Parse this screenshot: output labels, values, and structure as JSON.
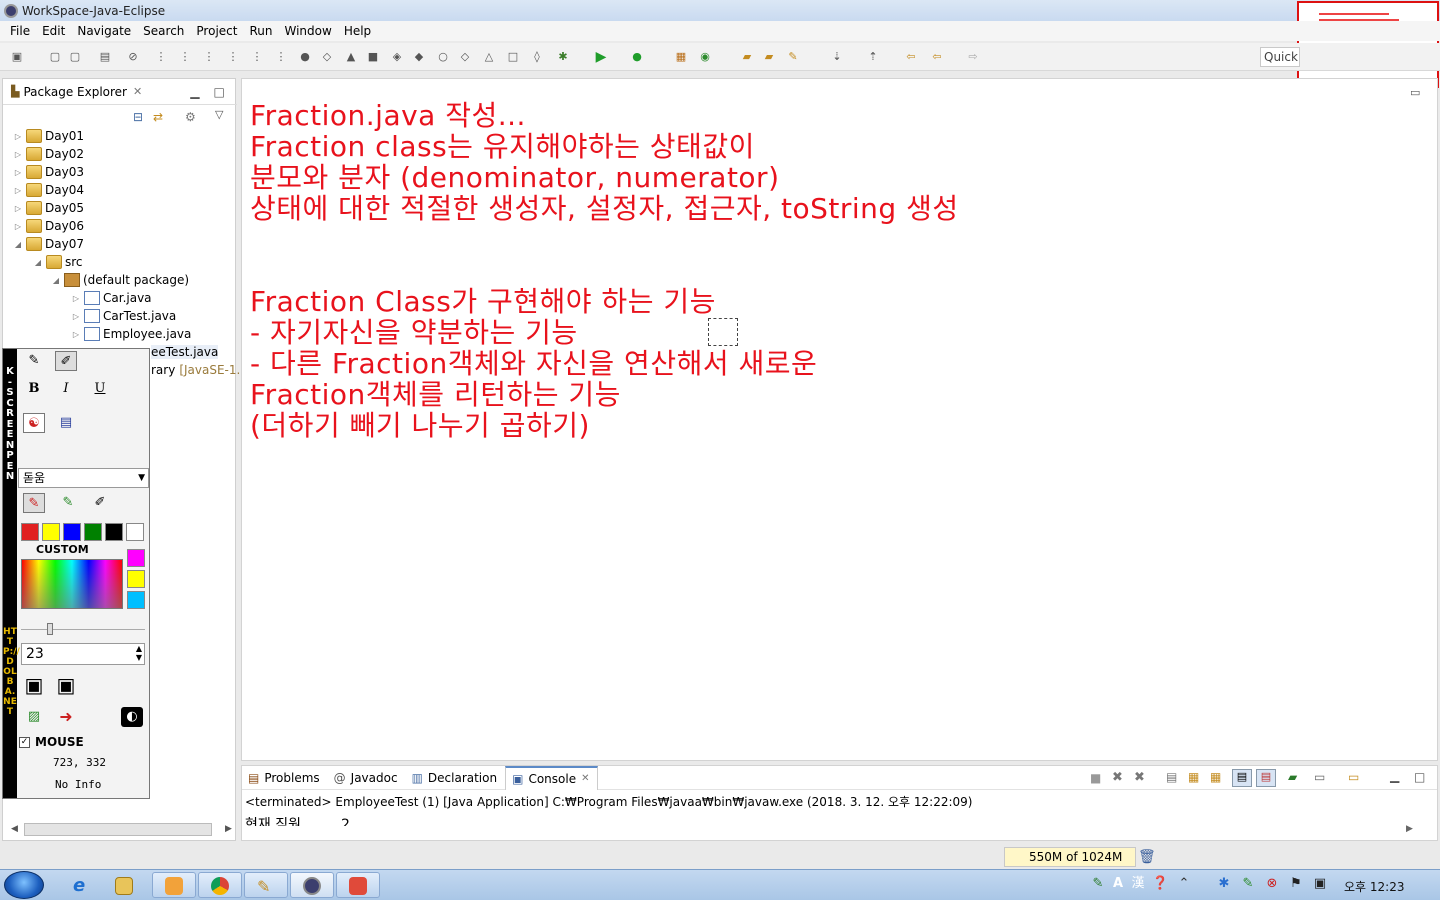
{
  "window": {
    "title_workspace": "WorkSpace",
    "title_sep1": " - ",
    "title_persp": "Java",
    "title_sep2": " - ",
    "title_app": "Eclipse"
  },
  "menu": [
    "File",
    "Edit",
    "Navigate",
    "Search",
    "Project",
    "Run",
    "Window",
    "Help"
  ],
  "quick_access": "Quick",
  "package_explorer": {
    "tab_label": "Package Explorer",
    "items": [
      {
        "label": "Day01"
      },
      {
        "label": "Day02"
      },
      {
        "label": "Day03"
      },
      {
        "label": "Day04"
      },
      {
        "label": "Day05"
      },
      {
        "label": "Day06"
      },
      {
        "label": "Day07"
      },
      {
        "label": "src"
      },
      {
        "label": "(default package)"
      },
      {
        "label": "Car.java"
      },
      {
        "label": "CarTest.java"
      },
      {
        "label": "Employee.java"
      },
      {
        "label": "eeTest.java"
      },
      {
        "label": "rary",
        "suffix": "[JavaSE-1.8"
      }
    ]
  },
  "notes": [
    "Fraction.java 작성...",
    "Fraction class는 유지해야하는 상태값이",
    "분모와 분자 (denominator, numerator)",
    "상태에 대한 적절한 생성자, 설정자, 접근자, toString 생성",
    "",
    "",
    "Fraction Class가 구현해야 하는 기능",
    "- 자기자신을 약분하는 기능",
    "- 다른 Fraction객체와 자신을 연산해서 새로운",
    "Fraction객체를 리턴하는 기능",
    "(더하기 빼기 나누기 곱하기)"
  ],
  "console": {
    "tabs": [
      {
        "label": "Problems"
      },
      {
        "label": "Javadoc"
      },
      {
        "label": "Declaration"
      },
      {
        "label": "Console"
      }
    ],
    "description": "<terminated> EmployeeTest (1) [Java Application] C:₩Program Files₩javaa₩bin₩javaw.exe (2018. 3. 12. 오후 12:22:09)",
    "output": "현재 직원 ... ... 2"
  },
  "heap": "550M of 1024M",
  "kscreen": {
    "side_title": "K-SCREEN PEN",
    "side_url": "HTTP://DOLBA.NET",
    "bold": "B",
    "italic": "I",
    "underline": "U",
    "font": "돋움",
    "custom_label": "CUSTOM",
    "size": "23",
    "mouse_label": "MOUSE",
    "coords": "723, 332",
    "info": "No Info",
    "colors": [
      "#e02020",
      "#ffff00",
      "#0000ff",
      "#008000",
      "#000000",
      "#ffffff"
    ],
    "extra_colors": [
      "#ff00ff",
      "#ffff00",
      "#00bfff"
    ]
  },
  "clock": "오후 12:23",
  "tray": {
    "ime_a": "A",
    "ime_han": "漢"
  }
}
